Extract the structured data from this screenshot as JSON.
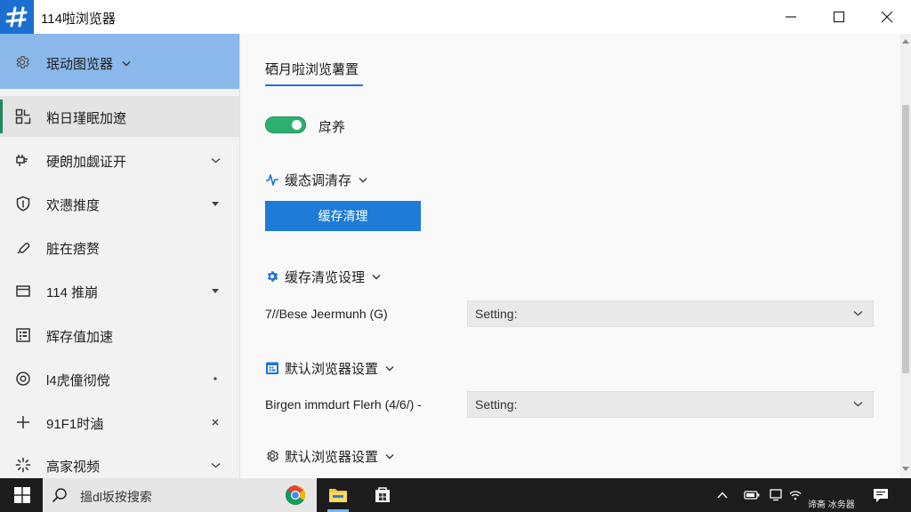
{
  "window": {
    "title": "114啦浏览器",
    "app_icon": "browser-logo-icon",
    "controls": [
      "minimize-icon",
      "maximize-icon",
      "close-icon"
    ]
  },
  "colors": {
    "accent_blue": "#1e7bd8",
    "app_icon_blue": "#1a6fd0",
    "sidebar_header": "#8ab8ea",
    "sidebar_bg": "#f2f2f2",
    "selected_bg": "#e4e4e4",
    "selected_bar": "#1e8a5e",
    "toggle_on": "#2db06f",
    "taskbar": "#1c1c1c"
  },
  "sidebar": {
    "header": {
      "label": "珉动图览器",
      "icon": "gear-icon",
      "trailing": "chevron-down-icon"
    },
    "items": [
      {
        "label": "粕日瑾眠加遼",
        "icon": "grid-icon",
        "selected": true,
        "trailing": ""
      },
      {
        "label": "硬朗加觑证开",
        "icon": "plug-icon",
        "selected": false,
        "trailing": "chevron-down-icon"
      },
      {
        "label": "欢懑推度",
        "icon": "shield-icon",
        "selected": false,
        "trailing": "caret-down-icon"
      },
      {
        "label": "脏在痞赘",
        "icon": "pen-icon",
        "selected": false,
        "trailing": ""
      },
      {
        "label": "114 推崩",
        "icon": "folder-icon",
        "selected": false,
        "trailing": "caret-down-icon"
      },
      {
        "label": "辉存值加速",
        "icon": "dashboard-icon",
        "selected": false,
        "trailing": ""
      },
      {
        "label": "l4虎僮彻傥",
        "icon": "target-icon",
        "selected": false,
        "trailing": "dot-icon"
      },
      {
        "label": "91F1时滷",
        "icon": "plus-icon",
        "selected": false,
        "trailing": "close-small-icon"
      },
      {
        "label": "高家视频",
        "icon": "sparkle-icon",
        "selected": false,
        "trailing": "chevron-down-icon"
      }
    ]
  },
  "main": {
    "tab": "硒月啦浏览薯置",
    "toggle": {
      "label": "戽养",
      "on": true
    },
    "sections": [
      {
        "title": "缓态调清存",
        "icon": "activity-icon"
      },
      {
        "title": "缓存清览设理",
        "icon": "gear-icon"
      },
      {
        "title": "默认浏览器设置",
        "icon": "calendar-icon"
      },
      {
        "title": "默认浏览器设置",
        "icon": "settings-outline-icon"
      }
    ],
    "clear_cache_button": "缓存清理",
    "rows": [
      {
        "label": "7//Bese Jeermunh (G)",
        "value": "Setting:"
      },
      {
        "label": "Birgen immdurt Flerh (4/6/) -",
        "value": "Setting:"
      }
    ]
  },
  "taskbar": {
    "search_placeholder": "搵dl坂按搜索",
    "pinned": [
      "chrome-icon",
      "file-explorer-icon",
      "store-icon"
    ],
    "tray_text": "谛斋 冰务器",
    "tray_icons": [
      "chevron-up-icon",
      "battery-icon",
      "display-icon",
      "wifi-icon",
      "notification-icon"
    ]
  }
}
